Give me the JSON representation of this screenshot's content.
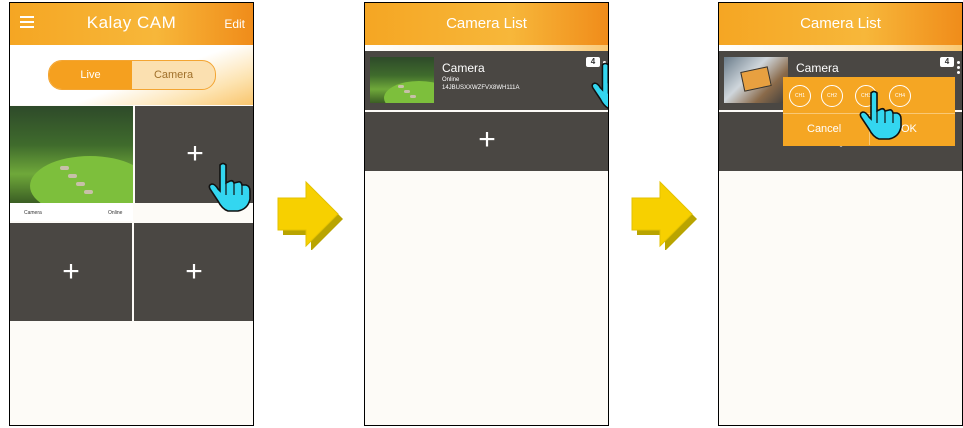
{
  "panel1": {
    "logo": "Kalay CAM",
    "edit": "Edit",
    "tabs": {
      "live": "Live",
      "camera": "Camera"
    },
    "tile_camera_name": "Camera",
    "tile_camera_status": "Online",
    "plus": "+"
  },
  "panel2": {
    "title": "Camera List",
    "camera": {
      "name": "Camera",
      "status": "Online",
      "uid": "14JBUSXXWZFVX8WH111A"
    },
    "badge": "4",
    "plus": "+"
  },
  "panel3": {
    "title": "Camera List",
    "camera": {
      "name": "Camera"
    },
    "badge": "4",
    "channels": [
      "CH1",
      "CH2",
      "CH3",
      "CH4"
    ],
    "cancel": "Cancel",
    "ok": "OK",
    "plus": "+"
  },
  "colors": {
    "accent": "#f5a623",
    "tile": "#4a4743",
    "arrow": "#f7d000",
    "hand": "#33d6f0"
  },
  "icons": [
    "menu-icon",
    "plus-icon",
    "arrow-right-icon",
    "pointing-hand-icon",
    "more-vert-icon"
  ]
}
